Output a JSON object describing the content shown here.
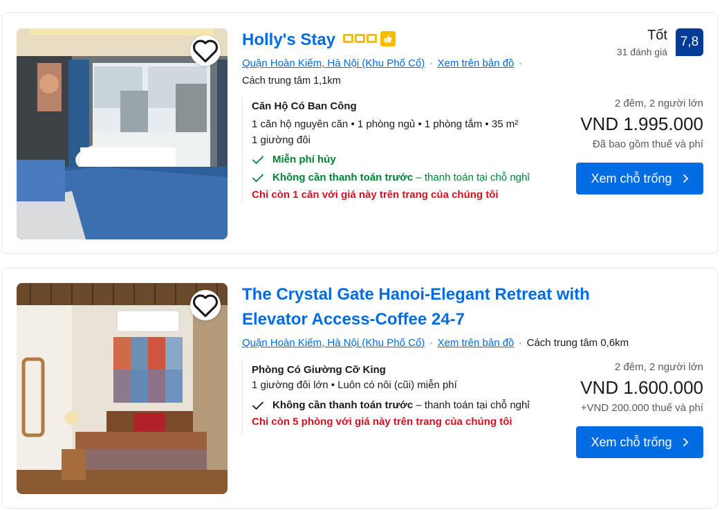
{
  "listings": [
    {
      "name": "Holly's Stay",
      "district_link": "Quận Hoàn Kiếm, Hà Nội (Khu Phố Cổ)",
      "map_link": "Xem trên bản đồ",
      "distance": "Cách trung tâm 1,1km",
      "score_label": "Tốt",
      "review_count": "31 đánh giá",
      "score": "7,8",
      "room_name": "Căn Hộ Có Ban Công",
      "room_details": "1 căn hộ nguyên căn • 1 phòng ngủ • 1 phòng tắm • 35 m²",
      "bed": "1 giường đôi",
      "free_cancel": "Miễn phí hủy",
      "no_prepay": "Không cần thanh toán trước",
      "pay_at_property": "– thanh toán tại chỗ nghỉ",
      "scarcity": "Chỉ còn 1 căn với giá này trên trang của chúng tôi",
      "stay_info": "2 đêm, 2 người lớn",
      "price": "VND 1.995.000",
      "tax_note": "Đã bao gồm thuế và phí",
      "cta": "Xem chỗ trống"
    },
    {
      "name": "The Crystal Gate Hanoi-Elegant Retreat with Elevator Access-Coffee 24-7",
      "district_link": "Quận Hoàn Kiếm, Hà Nội (Khu Phố Cổ)",
      "map_link": "Xem trên bản đồ",
      "distance": "Cách trung tâm 0,6km",
      "room_name": "Phòng Có Giường Cỡ King",
      "room_details": "1 giường đôi lớn • Luôn có nôi (cũi) miễn phí",
      "no_prepay": "Không cần thanh toán trước",
      "pay_at_property": "– thanh toán tại chỗ nghỉ",
      "scarcity": "Chỉ còn 5 phòng với giá này trên trang của chúng tôi",
      "stay_info": "2 đêm, 2 người lớn",
      "price": "VND 1.600.000",
      "tax_note": "+VND 200.000 thuế và phí",
      "cta": "Xem chỗ trống"
    }
  ],
  "icons": {
    "favorite": "heart-icon",
    "check": "check-icon",
    "chevron": "chevron-right-icon",
    "stars": "star-square-icon",
    "preferred": "thumbs-up-icon"
  },
  "colors": {
    "link": "#006ce4",
    "score_badge": "#003b95",
    "green": "#008234",
    "warning": "#d4111e",
    "star": "#febb02"
  }
}
